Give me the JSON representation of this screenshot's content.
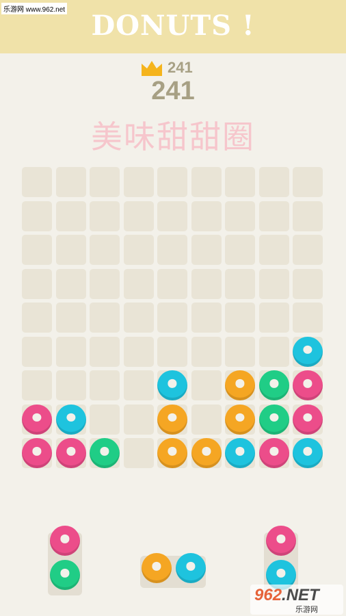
{
  "watermark_top": "乐游网 www.962.net",
  "header": {
    "title": "DONUTS !"
  },
  "stats": {
    "best_icon": "crown-icon",
    "best": "241",
    "score": "241"
  },
  "subtitle": "美味甜甜圈",
  "colors": {
    "pink": "#ec4d8a",
    "cyan": "#1ec3de",
    "green": "#20cd86",
    "orange": "#f5a623",
    "cell": "#e9e4d6",
    "header_bg": "#f0e2a9"
  },
  "board": {
    "rows": 9,
    "cols": 9,
    "pieces": [
      [
        "",
        "",
        "",
        "",
        "",
        "",
        "",
        "",
        ""
      ],
      [
        "",
        "",
        "",
        "",
        "",
        "",
        "",
        "",
        ""
      ],
      [
        "",
        "",
        "",
        "",
        "",
        "",
        "",
        "",
        ""
      ],
      [
        "",
        "",
        "",
        "",
        "",
        "",
        "",
        "",
        ""
      ],
      [
        "",
        "",
        "",
        "",
        "",
        "",
        "",
        "",
        ""
      ],
      [
        "",
        "",
        "",
        "",
        "",
        "",
        "",
        "",
        "cyan"
      ],
      [
        "",
        "",
        "",
        "",
        "cyan",
        "",
        "orange",
        "green",
        "pink"
      ],
      [
        "pink",
        "cyan",
        "",
        "",
        "orange",
        "",
        "orange",
        "green",
        "pink"
      ],
      [
        "pink",
        "pink",
        "green",
        "",
        "orange",
        "orange",
        "cyan",
        "pink",
        "cyan"
      ]
    ]
  },
  "trays": [
    {
      "id": "left",
      "orientation": "vertical",
      "pieces": [
        "pink",
        "green"
      ]
    },
    {
      "id": "center",
      "orientation": "horizontal",
      "pieces": [
        "orange",
        "cyan"
      ]
    },
    {
      "id": "right",
      "orientation": "vertical",
      "pieces": [
        "pink",
        "cyan"
      ]
    }
  ],
  "watermark_bottom": {
    "logo": "962",
    "suffix": ".NET",
    "text": "乐游网"
  }
}
